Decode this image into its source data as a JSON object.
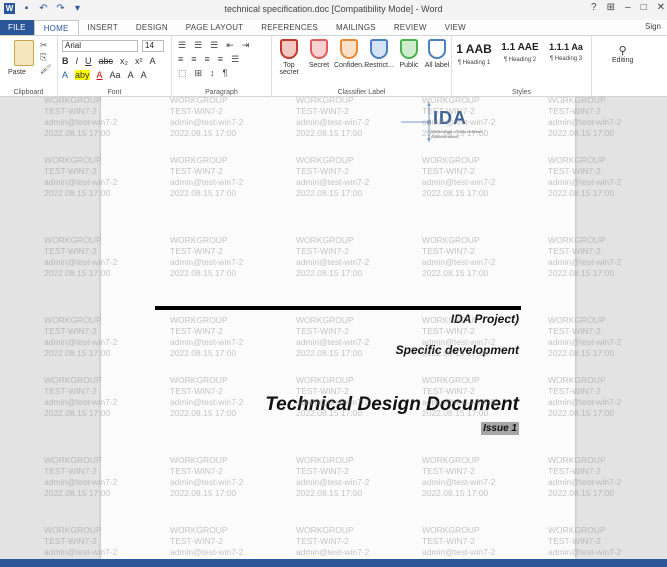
{
  "titlebar": {
    "title": "technical specification.doc [Compatibility Mode] - Word",
    "app_icon": "W",
    "help": "?",
    "ribbon_display": "⊞",
    "minimize": "–",
    "maximize": "□",
    "close": "✕"
  },
  "tabs": [
    "FILE",
    "HOME",
    "INSERT",
    "DESIGN",
    "PAGE LAYOUT",
    "REFERENCES",
    "MAILINGS",
    "REVIEW",
    "VIEW"
  ],
  "active_tab": "HOME",
  "signin": "Sign",
  "ribbon": {
    "clipboard": {
      "paste": "Paste",
      "label": "Clipboard"
    },
    "font": {
      "font_name": "Arial",
      "font_size": "14",
      "row2": [
        "B",
        "I",
        "U",
        "abc",
        "x₂",
        "x²",
        "A"
      ],
      "row3": [
        "A",
        "aby",
        "A",
        "Aa",
        "A",
        "A"
      ],
      "label": "Font"
    },
    "paragraph": {
      "row1": [
        "☰",
        "☰",
        "☰",
        "⇤",
        "⇥"
      ],
      "row2": [
        "≡",
        "≡",
        "≡",
        "≡",
        "☰"
      ],
      "row3": [
        "⬚",
        "⊞",
        "↕",
        "¶"
      ],
      "label": "Paragraph"
    },
    "classifier": {
      "label": "Classifier Label",
      "buttons": [
        {
          "label": "Top secret",
          "color": "#c0392b"
        },
        {
          "label": "Secret",
          "color": "#e05d5d"
        },
        {
          "label": "Confiden...",
          "color": "#e88a3a"
        },
        {
          "label": "Restrict...",
          "color": "#4a7fc1"
        },
        {
          "label": "Public",
          "color": "#4caf50"
        },
        {
          "label": "All label",
          "color": "#4a7fc1"
        }
      ]
    },
    "styles": {
      "label": "Styles",
      "items": [
        {
          "sample": "1 AAB",
          "name": "¶ Heading 1"
        },
        {
          "sample": "1.1 AAE",
          "name": "¶ Heading 2"
        },
        {
          "sample": "1.1.1 Aa",
          "name": "¶ Heading 3"
        }
      ]
    },
    "editing": {
      "label": "Editing"
    }
  },
  "watermark": [
    "WORKGROUP",
    "TEST-WIN7-2",
    "admin@test-win7-2",
    "2022.08.15 17:00"
  ],
  "document": {
    "logo_text": "IDA",
    "logo_sub": "Interchange of Data between Administrations",
    "project": "IDA Project)",
    "subtitle": "Specific development",
    "title": "Technical Design Document",
    "issue": "Issue 1"
  },
  "colors": {
    "accent": "#2b579a"
  }
}
